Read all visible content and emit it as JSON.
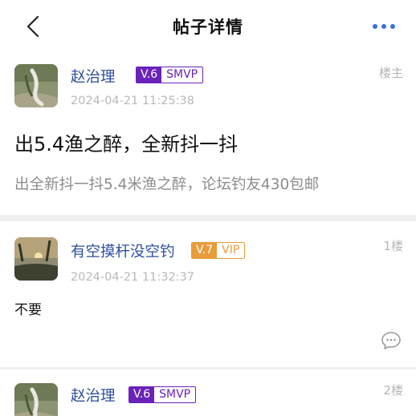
{
  "header": {
    "title": "帖子详情",
    "back_icon": "chevron-left-icon",
    "more_icon": "more-dots-icon",
    "accent_color": "#3b6fd6"
  },
  "post": {
    "author": "赵治理",
    "level": "V.6",
    "level_tag": "SMVP",
    "time": "2024-04-21 11:25:38",
    "floor": "楼主",
    "title": "出5.4渔之醉，全新抖一抖",
    "body": "出全新抖一抖5.4米渔之醉，论坛钓友430包邮"
  },
  "replies": [
    {
      "author": "有空摸杆没空钓",
      "level": "V.7",
      "level_tag": "VIP",
      "time": "2024-04-21 11:32:37",
      "floor": "1楼",
      "text": "不要",
      "comment_icon": "comment-bubble-icon"
    },
    {
      "author": "赵治理",
      "level": "V.6",
      "level_tag": "SMVP",
      "floor": "2楼"
    }
  ],
  "colors": {
    "username": "#2c4f9e",
    "smvp": "#6a22b8",
    "vip": "#e89c3a"
  }
}
